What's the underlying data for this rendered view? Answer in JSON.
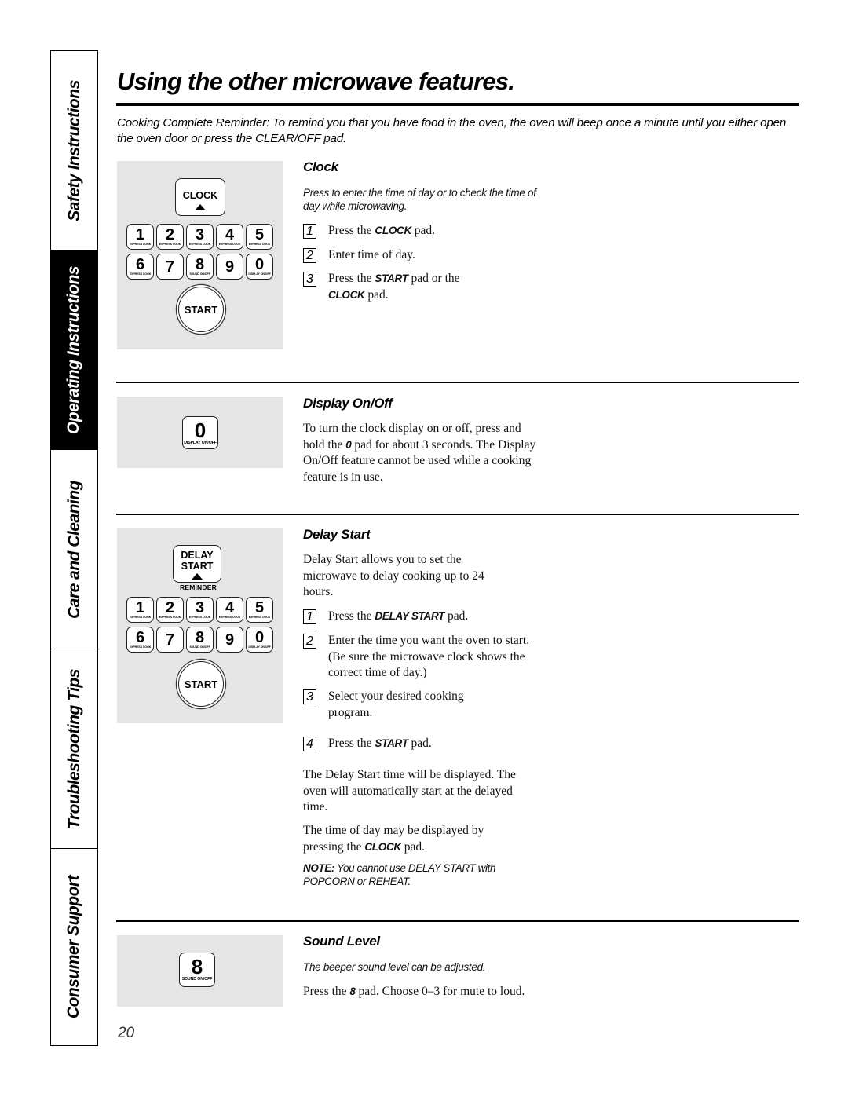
{
  "side_tabs": [
    {
      "label": "Safety Instructions",
      "active": false
    },
    {
      "label": "Operating Instructions",
      "active": true
    },
    {
      "label": "Care and Cleaning",
      "active": false
    },
    {
      "label": "Troubleshooting Tips",
      "active": false
    },
    {
      "label": "Consumer Support",
      "active": false
    }
  ],
  "title": "Using the other microwave features.",
  "intro": "Cooking Complete Reminder: To remind you that you have food in the oven, the oven will beep once a minute until you either open the oven door or press the CLEAR/OFF pad.",
  "keypad": {
    "keys": [
      {
        "num": "1",
        "sub": "EXPRESS COOK"
      },
      {
        "num": "2",
        "sub": "EXPRESS COOK"
      },
      {
        "num": "3",
        "sub": "EXPRESS COOK"
      },
      {
        "num": "4",
        "sub": "EXPRESS COOK"
      },
      {
        "num": "5",
        "sub": "EXPRESS COOK"
      },
      {
        "num": "6",
        "sub": "EXPRESS COOK"
      },
      {
        "num": "7",
        "sub": ""
      },
      {
        "num": "8",
        "sub": "SOUND ON/OFF"
      },
      {
        "num": "9",
        "sub": ""
      },
      {
        "num": "0",
        "sub": "DISPLAY ON/OFF"
      }
    ],
    "start_label": "START",
    "clock_label": "CLOCK",
    "delay_start_label_1": "DELAY",
    "delay_start_label_2": "START",
    "reminder_label": "REMINDER"
  },
  "sections": {
    "clock": {
      "heading": "Clock",
      "subtitle": "Press to enter the time of day or to check the time of day while microwaving.",
      "steps": [
        {
          "n": "1",
          "pre": "Press the ",
          "bold": "CLOCK",
          "post": " pad."
        },
        {
          "n": "2",
          "pre": "Enter time of day.",
          "bold": "",
          "post": ""
        },
        {
          "n": "3",
          "pre": "Press the ",
          "bold": "START",
          "post": " pad or the",
          "bold2": "CLOCK",
          "post2": " pad."
        }
      ]
    },
    "display": {
      "heading": "Display On/Off",
      "key_num": "0",
      "key_sub": "DISPLAY ON/OFF",
      "text_pre": "To turn the clock display on or off, press and hold the ",
      "text_bold": "0",
      "text_post": " pad for about 3 seconds. The Display On/Off feature cannot be used while a cooking feature is in use."
    },
    "delay": {
      "heading": "Delay Start",
      "intro": "Delay Start allows you to set the microwave to delay cooking up to 24 hours.",
      "steps": [
        {
          "n": "1",
          "pre": "Press the ",
          "bold": "DELAY START",
          "post": " pad."
        },
        {
          "n": "2",
          "pre": "Enter the time you want the oven to start. (Be sure the microwave clock shows the correct time of day.)",
          "bold": "",
          "post": ""
        },
        {
          "n": "3",
          "pre": "Select your desired cooking program.",
          "bold": "",
          "post": ""
        },
        {
          "n": "4",
          "pre": "Press the ",
          "bold": "START",
          "post": " pad."
        }
      ],
      "para1": "The Delay Start time will be displayed. The oven will automatically start at the delayed time.",
      "para2_pre": "The time of day may be displayed by pressing the ",
      "para2_bold": "CLOCK",
      "para2_post": " pad.",
      "note_label": "NOTE:",
      "note_text": " You cannot use DELAY START with POPCORN or REHEAT."
    },
    "sound": {
      "heading": "Sound Level",
      "key_num": "8",
      "key_sub": "SOUND ON/OFF",
      "subtitle": "The beeper sound level can be adjusted.",
      "text_pre": "Press the ",
      "text_bold": "8",
      "text_post": " pad. Choose 0–3 for mute to loud."
    }
  },
  "page_number": "20"
}
